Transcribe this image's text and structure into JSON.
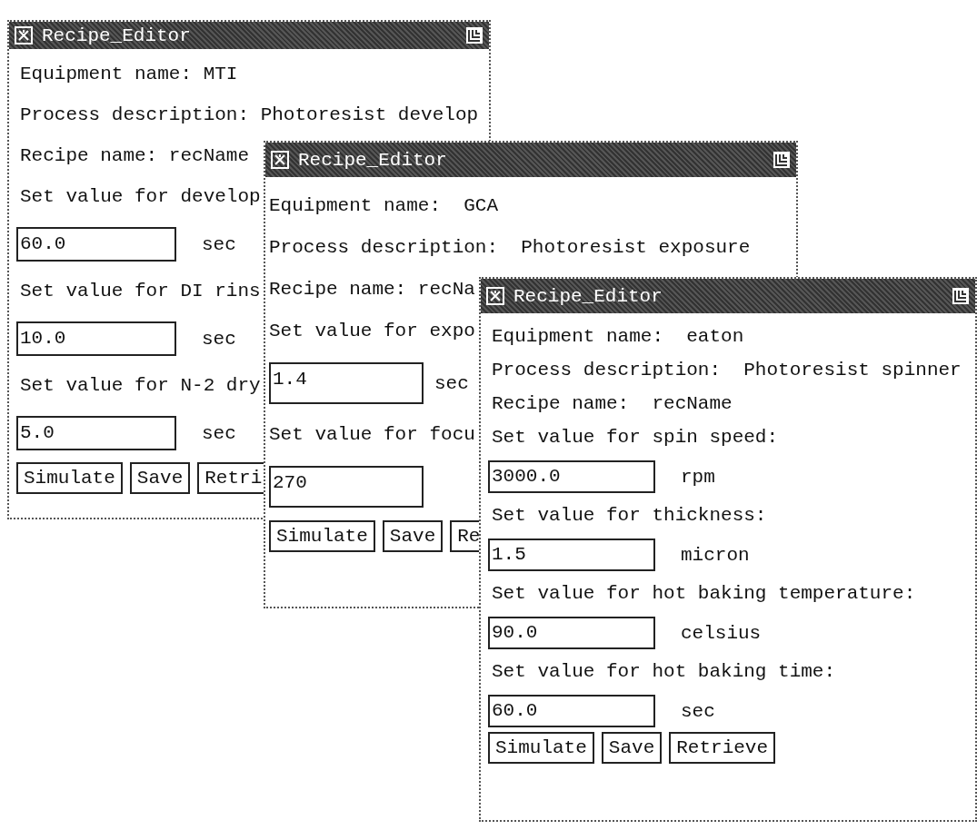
{
  "windows": [
    {
      "title": "Recipe_Editor",
      "items": [
        {
          "kind": "text",
          "text": "Equipment name: MTI"
        },
        {
          "kind": "text",
          "text": "Process description: Photoresist develop"
        },
        {
          "kind": "text",
          "text": "Recipe name: recName"
        },
        {
          "kind": "text",
          "text": "Set value for develop"
        },
        {
          "kind": "field",
          "value": "60.0",
          "unit": "sec"
        },
        {
          "kind": "text",
          "text": "Set value for DI rins"
        },
        {
          "kind": "field",
          "value": "10.0",
          "unit": "sec"
        },
        {
          "kind": "text",
          "text": "Set value for N-2 dry"
        },
        {
          "kind": "field",
          "value": "5.0",
          "unit": "sec"
        },
        {
          "kind": "buttons",
          "buttons": [
            "Simulate",
            "Save",
            "Retri"
          ]
        }
      ]
    },
    {
      "title": "Recipe_Editor",
      "items": [
        {
          "kind": "text",
          "text": "Equipment name:  GCA"
        },
        {
          "kind": "text",
          "text": "Process description:  Photoresist exposure"
        },
        {
          "kind": "text",
          "text": "Recipe name: recNa"
        },
        {
          "kind": "text",
          "text": "Set value for expo"
        },
        {
          "kind": "field",
          "value": "1.4",
          "unit": "sec"
        },
        {
          "kind": "text",
          "text": "Set value for focu"
        },
        {
          "kind": "field",
          "value": "270"
        },
        {
          "kind": "buttons",
          "buttons": [
            "Simulate",
            "Save",
            "Re"
          ]
        }
      ]
    },
    {
      "title": "Recipe_Editor",
      "items": [
        {
          "kind": "text",
          "text": "Equipment name:  eaton"
        },
        {
          "kind": "text",
          "text": "Process description:  Photoresist spinner"
        },
        {
          "kind": "text",
          "text": "Recipe name:  recName"
        },
        {
          "kind": "text",
          "text": "Set value for spin speed:"
        },
        {
          "kind": "field",
          "value": "3000.0",
          "unit": "rpm"
        },
        {
          "kind": "text",
          "text": "Set value for thickness:"
        },
        {
          "kind": "field",
          "value": "1.5",
          "unit": "micron"
        },
        {
          "kind": "text",
          "text": "Set value for hot baking temperature:"
        },
        {
          "kind": "field",
          "value": "90.0",
          "unit": "celsius"
        },
        {
          "kind": "text",
          "text": "Set value for hot baking time:"
        },
        {
          "kind": "field",
          "value": "60.0",
          "unit": "sec"
        },
        {
          "kind": "buttons",
          "buttons": [
            "Simulate",
            "Save",
            "Retrieve"
          ]
        }
      ]
    }
  ]
}
